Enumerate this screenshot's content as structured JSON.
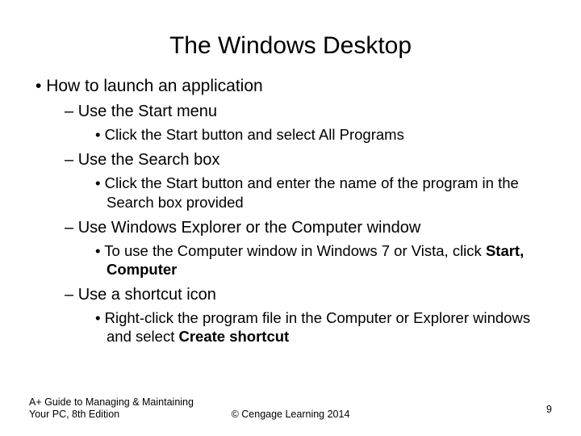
{
  "title": "The Windows Desktop",
  "b1": "How to launch an application",
  "b2a": "Use the Start menu",
  "b3a": "Click the Start button and select All Programs",
  "b2b": "Use the Search box",
  "b3b": "Click the Start button and enter the name of the program in the Search box provided",
  "b2c": "Use Windows Explorer or the Computer window",
  "b3c_pre": "To use the Computer window in Windows 7 or Vista, click ",
  "b3c_bold": "Start, Computer",
  "b2d": "Use a shortcut icon",
  "b3d_pre": "Right-click the program file in the Computer or Explorer windows and select ",
  "b3d_bold": "Create shortcut",
  "footer_left_line1": "A+ Guide to Managing & Maintaining",
  "footer_left_line2": "Your PC, 8th Edition",
  "footer_center": "© Cengage Learning 2014",
  "footer_right": "9"
}
